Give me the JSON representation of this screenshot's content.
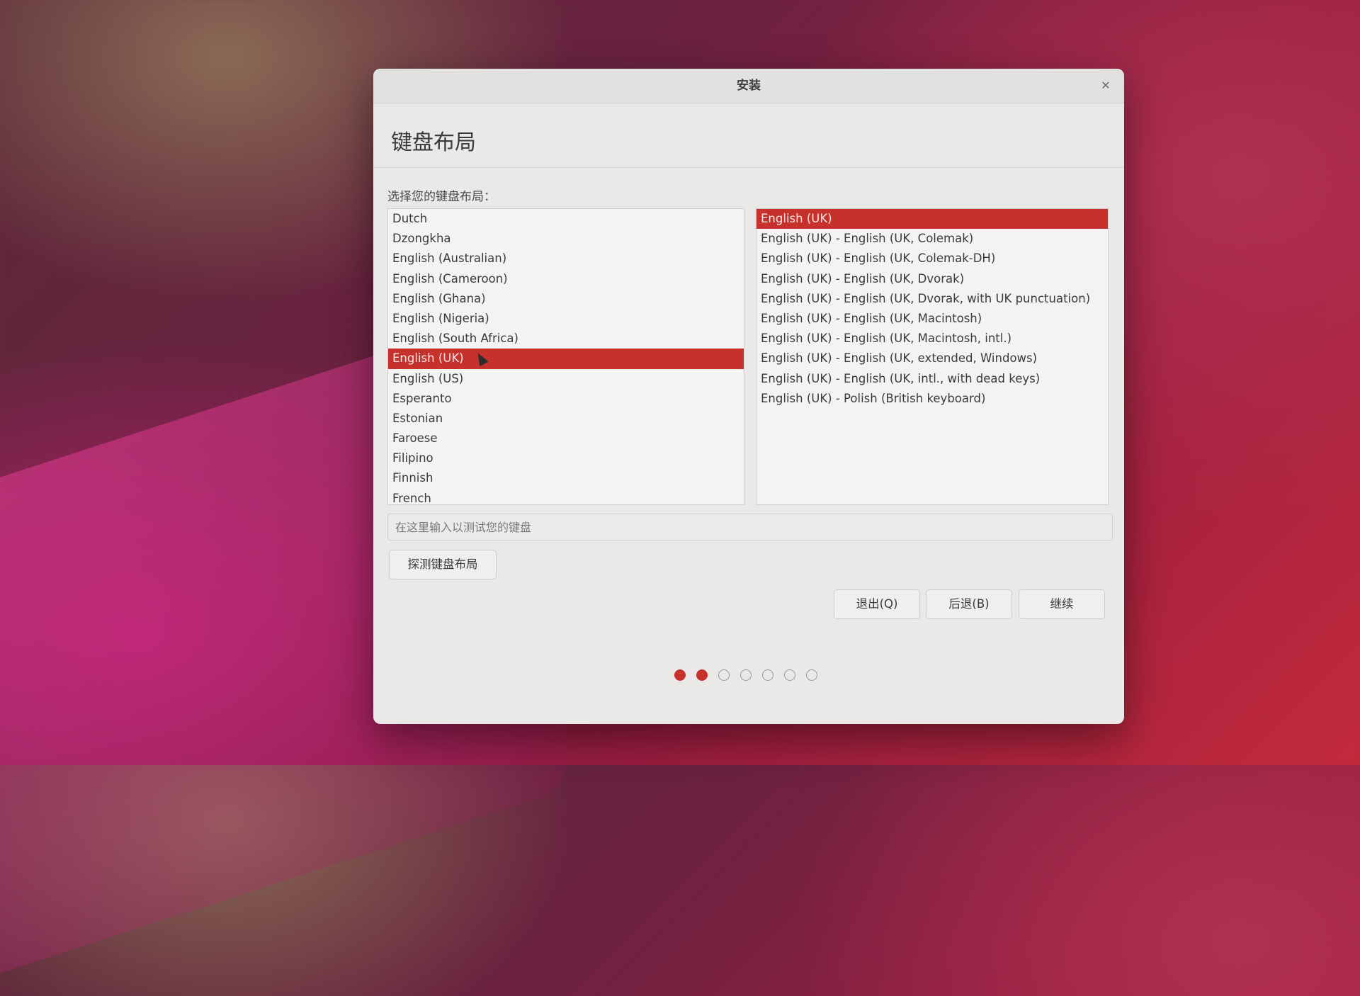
{
  "window": {
    "title": "安装",
    "close_icon": "close-icon"
  },
  "page": {
    "heading": "键盘布局",
    "prompt": "选择您的键盘布局："
  },
  "layouts": {
    "items": [
      {
        "label": "Dutch"
      },
      {
        "label": "Dzongkha"
      },
      {
        "label": "English (Australian)"
      },
      {
        "label": "English (Cameroon)"
      },
      {
        "label": "English (Ghana)"
      },
      {
        "label": "English (Nigeria)"
      },
      {
        "label": "English (South Africa)"
      },
      {
        "label": "English (UK)",
        "selected": true
      },
      {
        "label": "English (US)"
      },
      {
        "label": "Esperanto"
      },
      {
        "label": "Estonian"
      },
      {
        "label": "Faroese"
      },
      {
        "label": "Filipino"
      },
      {
        "label": "Finnish"
      },
      {
        "label": "French"
      }
    ]
  },
  "variants": {
    "items": [
      {
        "label": "English (UK)",
        "selected": true
      },
      {
        "label": "English (UK) - English (UK, Colemak)"
      },
      {
        "label": "English (UK) - English (UK, Colemak-DH)"
      },
      {
        "label": "English (UK) - English (UK, Dvorak)"
      },
      {
        "label": "English (UK) - English (UK, Dvorak, with UK punctuation)"
      },
      {
        "label": "English (UK) - English (UK, Macintosh)"
      },
      {
        "label": "English (UK) - English (UK, Macintosh, intl.)"
      },
      {
        "label": "English (UK) - English (UK, extended, Windows)"
      },
      {
        "label": "English (UK) - English (UK, intl., with dead keys)"
      },
      {
        "label": "English (UK) - Polish (British keyboard)"
      }
    ]
  },
  "test_input": {
    "value": "",
    "placeholder": "在这里输入以测试您的键盘"
  },
  "buttons": {
    "detect": "探测键盘布局",
    "quit": "退出(Q)",
    "back": "后退(B)",
    "continue": "继续"
  },
  "progress": {
    "total_steps": 7,
    "completed_steps": 2
  },
  "colors": {
    "accent": "#c7312b",
    "window_bg": "#ebe9e8"
  }
}
